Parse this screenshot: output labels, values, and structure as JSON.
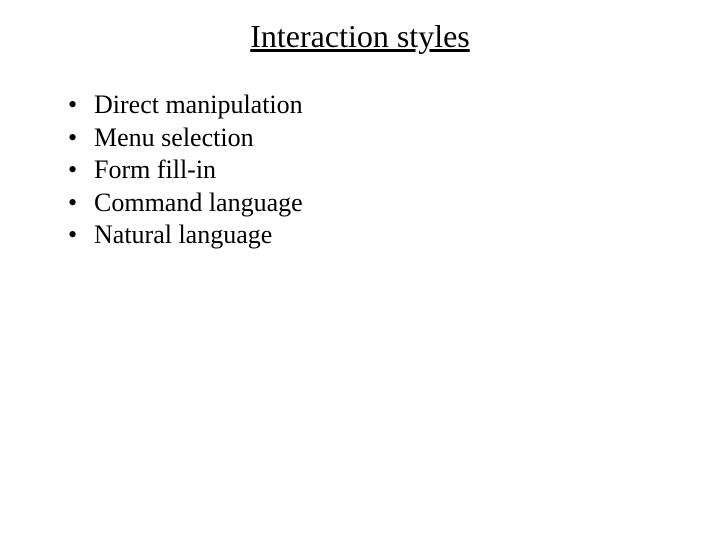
{
  "title": "Interaction styles",
  "bullets": [
    "Direct manipulation",
    "Menu selection",
    "Form fill-in",
    "Command language",
    "Natural language"
  ],
  "bullet_marker": "•"
}
